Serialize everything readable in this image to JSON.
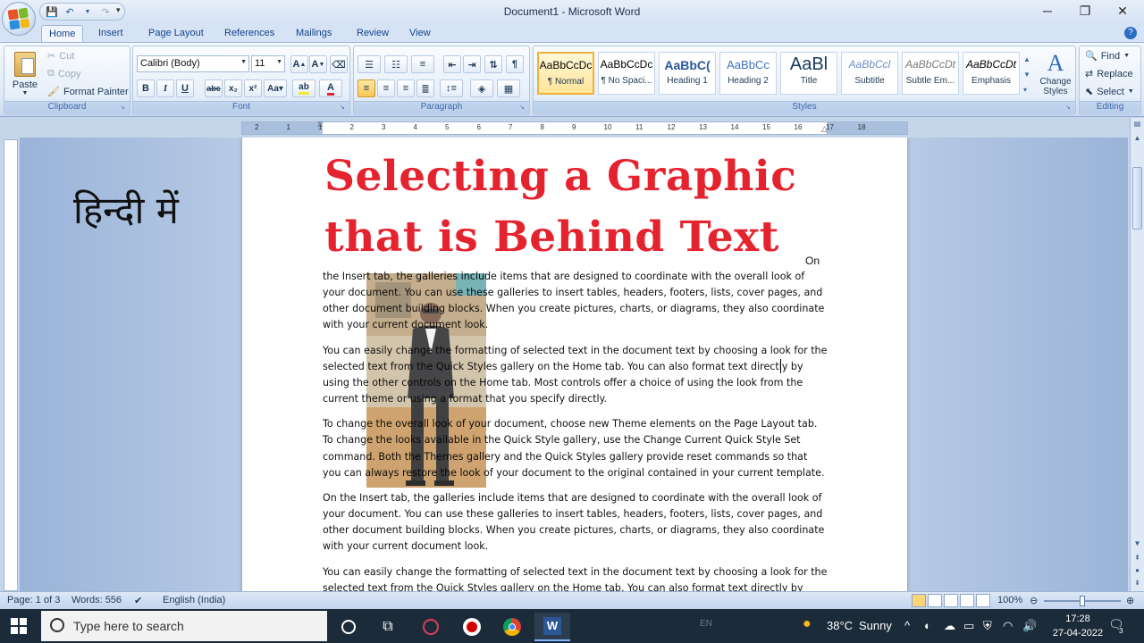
{
  "window": {
    "title": "Document1 - Microsoft Word"
  },
  "ribbon": {
    "tabs": [
      "Home",
      "Insert",
      "Page Layout",
      "References",
      "Mailings",
      "Review",
      "View"
    ],
    "clipboard": {
      "paste": "Paste",
      "cut": "Cut",
      "copy": "Copy",
      "format_painter": "Format Painter",
      "label": "Clipboard"
    },
    "font": {
      "name": "Calibri (Body)",
      "size": "11",
      "label": "Font"
    },
    "paragraph": {
      "label": "Paragraph"
    },
    "styles": {
      "label": "Styles",
      "items": [
        {
          "sample": "AaBbCcDc",
          "name": "¶ Normal"
        },
        {
          "sample": "AaBbCcDc",
          "name": "¶ No Spaci..."
        },
        {
          "sample": "AaBbC(",
          "name": "Heading 1"
        },
        {
          "sample": "AaBbCc",
          "name": "Heading 2"
        },
        {
          "sample": "AaBl",
          "name": "Title"
        },
        {
          "sample": "AaBbCcl",
          "name": "Subtitle"
        },
        {
          "sample": "AaBbCcDt",
          "name": "Subtle Em..."
        },
        {
          "sample": "AaBbCcDt",
          "name": "Emphasis"
        }
      ],
      "change_styles": "Change Styles"
    },
    "editing": {
      "find": "Find",
      "replace": "Replace",
      "select": "Select",
      "label": "Editing"
    }
  },
  "ruler": {
    "numbers": [
      "2",
      "1",
      "1",
      "2",
      "3",
      "4",
      "5",
      "6",
      "7",
      "8",
      "9",
      "10",
      "11",
      "12",
      "13",
      "14",
      "15",
      "16",
      "17",
      "18"
    ]
  },
  "document": {
    "side_text": "हिन्दी में",
    "heading_line1": "Selecting a Graphic",
    "heading_line2": "that is Behind Text",
    "on_word": "On",
    "paragraphs": [
      "the Insert tab, the galleries include items that are designed to coordinate with the overall look of your document. You can use these galleries to insert tables, headers, footers, lists, cover pages, and other document building blocks. When you create pictures, charts, or diagrams, they also coordinate with your current document look.",
      "You can easily change the formatting of selected text in the document text by choosing a look for the selected text from the Quick Styles gallery on the Home tab. You can also format text directly by using the other controls on the Home tab. Most controls offer a choice of using the look from the current theme or using a format that you specify directly.",
      "To change the overall look of your document, choose new Theme elements on the Page Layout tab. To change the looks available in the Quick Style gallery, use the Change Current Quick Style Set command. Both the Themes gallery and the Quick Styles gallery provide reset commands so that you can always restore the look of your document to the original contained in your current template.",
      "On the Insert tab, the galleries include items that are designed to coordinate with the overall look of your document. You can use these galleries to insert tables, headers, footers, lists, cover pages, and other document building blocks. When you create pictures, charts, or diagrams, they also coordinate with your current document look.",
      "You can easily change the formatting of selected text in the document text by choosing a look for the selected text from the Quick Styles gallery on the Home tab. You can also format text directly by"
    ]
  },
  "status": {
    "page": "Page: 1 of 3",
    "words": "Words: 556",
    "language": "English (India)",
    "zoom": "100%"
  },
  "taskbar": {
    "search_placeholder": "Type here to search",
    "lang_hint": "EN",
    "weather_temp": "38°C",
    "weather_desc": "Sunny",
    "time": "17:28",
    "date": "27-04-2022",
    "notifications": "3"
  },
  "colors": {
    "heading_red": "#e5232e",
    "ribbon_blue": "#d6e3f4",
    "taskbar": "#1c2b3a"
  }
}
